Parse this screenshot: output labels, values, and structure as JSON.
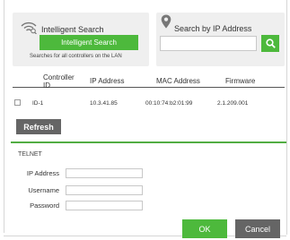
{
  "intelligent_search": {
    "title": "Intelligent Search",
    "button": "Intelligent Search",
    "hint": "Searches for all controllers on the LAN",
    "icon": "wifi-search-icon"
  },
  "ip_search": {
    "title": "Search by IP Address",
    "input_value": "",
    "icon": "location-pin-icon",
    "button_icon": "search-icon"
  },
  "table": {
    "headers": [
      "Controller ID",
      "IP Address",
      "MAC Address",
      "Firmware"
    ],
    "rows": [
      {
        "checked": false,
        "id": "ID-1",
        "ip": "10.3.41.85",
        "mac": "00:10:74:b2:01:99",
        "firmware": "2.1.209.001"
      }
    ]
  },
  "refresh_label": "Refresh",
  "telnet": {
    "title": "TELNET",
    "ip_label": "IP Address",
    "ip_value": "",
    "username_label": "Username",
    "username_value": "",
    "password_label": "Password",
    "password_value": ""
  },
  "ok_label": "OK",
  "cancel_label": "Cancel",
  "colors": {
    "accent": "#4db93c",
    "dark_button": "#656565",
    "panel": "#efefef"
  }
}
